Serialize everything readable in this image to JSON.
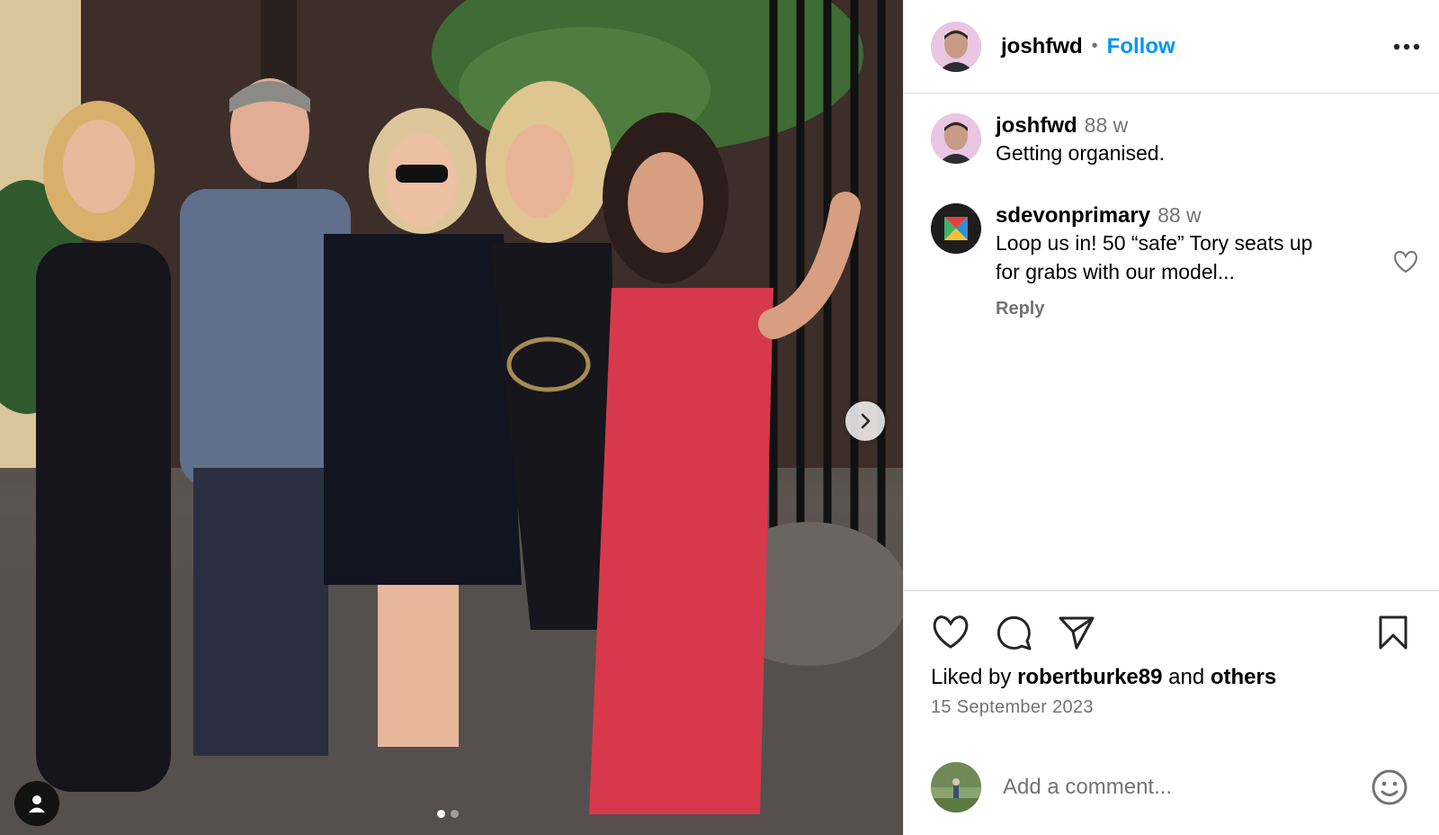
{
  "post": {
    "author": "joshfwd",
    "follow_label": "Follow",
    "separator": "•",
    "more_icon": "more-options-icon"
  },
  "media": {
    "carousel_index": 1,
    "carousel_count": 2,
    "next_icon": "chevron-right-icon",
    "tag_icon": "user-icon"
  },
  "comments": [
    {
      "username": "joshfwd",
      "time": "88 w",
      "text": "Getting organised."
    },
    {
      "username": "sdevonprimary",
      "time": "88 w",
      "text_line1": "Loop us in! 50 “safe” Tory seats up",
      "text_line2": "for grabs with our model...",
      "reply_label": "Reply"
    }
  ],
  "actions": {
    "like_icon": "heart-icon",
    "comment_icon": "comment-icon",
    "share_icon": "share-icon",
    "save_icon": "bookmark-icon"
  },
  "likes": {
    "prefix": "Liked by",
    "user": "robertburke89",
    "middle": "and",
    "others": "others"
  },
  "date": "15 September 2023",
  "add_comment": {
    "placeholder": "Add a comment...",
    "emoji_icon": "emoji-icon"
  },
  "colors": {
    "accent": "#0095f6",
    "muted": "#737373",
    "divider": "#dbdbdb"
  }
}
